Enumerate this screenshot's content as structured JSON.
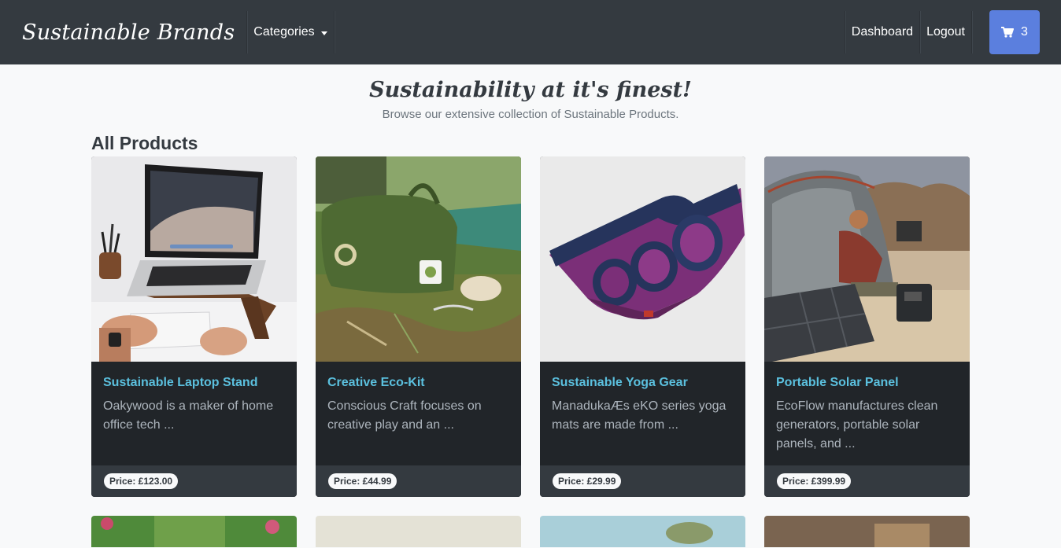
{
  "navbar": {
    "brand": "Sustainable Brands",
    "categories_label": "Categories",
    "dashboard_label": "Dashboard",
    "logout_label": "Logout",
    "cart_count": "3"
  },
  "hero": {
    "tagline": "Sustainability at it's finest!",
    "subtitle": "Browse our extensive collection of Sustainable Products."
  },
  "section": {
    "title": "All Products"
  },
  "products": [
    {
      "title": "Sustainable Laptop Stand",
      "description": "Oakywood is a maker of home office tech ...",
      "price": "Price: £123.00"
    },
    {
      "title": "Creative Eco-Kit",
      "description": "Conscious Craft focuses on creative play and an ...",
      "price": "Price: £44.99"
    },
    {
      "title": "Sustainable Yoga Gear",
      "description": "ManadukaÆs eKO series yoga mats are made from ...",
      "price": "Price: £29.99"
    },
    {
      "title": "Portable Solar Panel",
      "description": "EcoFlow manufactures clean generators, portable solar panels, and ...",
      "price": "Price: £399.99"
    }
  ],
  "colors": {
    "navbar_bg": "#343a40",
    "cart_button": "#5b7fde",
    "card_title": "#5bc0de",
    "card_bg": "#212529"
  }
}
